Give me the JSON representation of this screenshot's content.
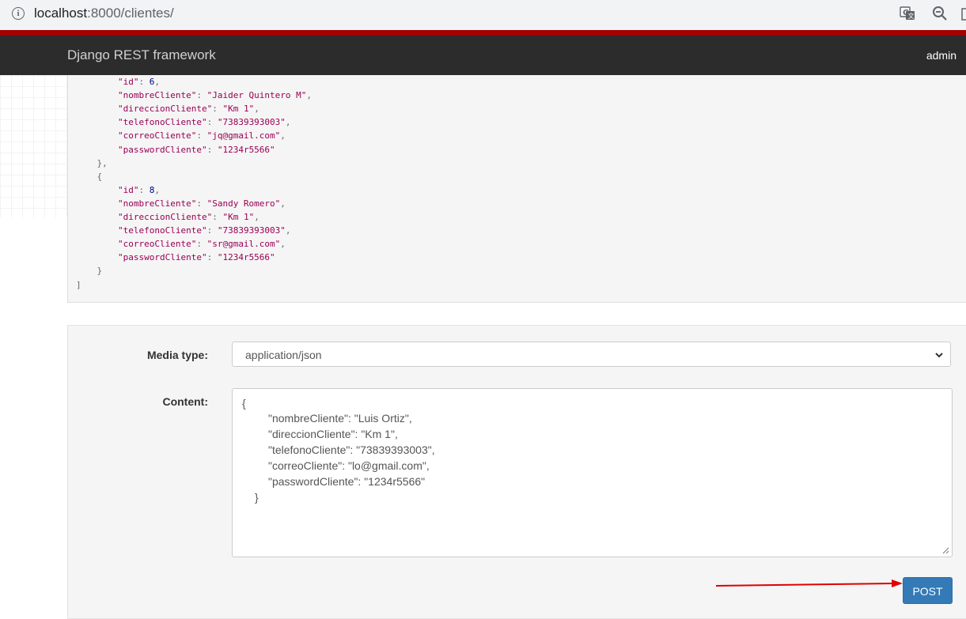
{
  "browser": {
    "url_host": "localhost",
    "url_rest": ":8000/clientes/",
    "icons": [
      "info-icon",
      "translate-icon",
      "zoom-icon",
      "more-icon"
    ]
  },
  "navbar": {
    "brand": "Django REST framework",
    "user": "admin"
  },
  "response": {
    "records": [
      {
        "id": 6,
        "nombreCliente": "Jaider Quintero M",
        "direccionCliente": "Km 1",
        "telefonoCliente": "73839393003",
        "correoCliente": "jq@gmail.com",
        "passwordCliente": "1234r5566"
      },
      {
        "id": 8,
        "nombreCliente": "Sandy Romero",
        "direccionCliente": "Km 1",
        "telefonoCliente": "73839393003",
        "correoCliente": "sr@gmail.com",
        "passwordCliente": "1234r5566"
      }
    ]
  },
  "form": {
    "media_type_label": "Media type:",
    "media_type_value": "application/json",
    "content_label": "Content:",
    "content_lines": [
      "{",
      "\"nombreCliente\": \"Luis Ortiz\",",
      "\"direccionCliente\": \"Km 1\",",
      "\"telefonoCliente\": \"73839393003\",",
      "\"correoCliente\": \"lo@gmail.com\",",
      "\"passwordCliente\": \"1234r5566\"",
      "}"
    ],
    "post_label": "POST"
  },
  "colors": {
    "navbar_bg": "#2c2c2c",
    "navbar_accent": "#a30000",
    "post_button": "#337ab7",
    "annotation_arrow": "#e00000"
  }
}
